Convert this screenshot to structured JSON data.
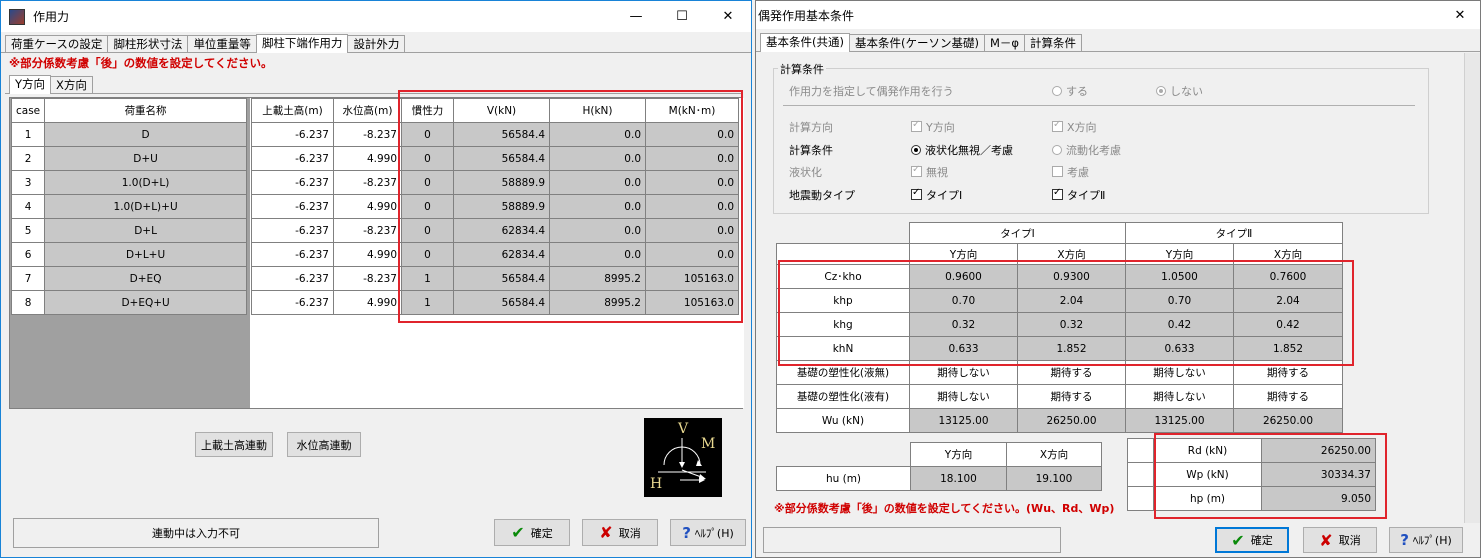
{
  "w1": {
    "title": "作用力",
    "tabs": [
      "荷重ケースの設定",
      "脚柱形状寸法",
      "単位重量等",
      "脚柱下端作用力",
      "設計外力"
    ],
    "note": "※部分係数考慮「後」の数値を設定してください。",
    "subtabs": [
      "Y方向",
      "X方向"
    ],
    "left_headers": [
      "case",
      "荷重名称"
    ],
    "right_headers": [
      "上載土高(m)",
      "水位高(m)",
      "慣性力",
      "V(kN)",
      "H(kN)",
      "M(kN･m)"
    ],
    "rows": [
      {
        "case": "1",
        "name": "D",
        "soil": "-6.237",
        "water": "-8.237",
        "inertia": "0",
        "v": "56584.4",
        "h": "0.0",
        "m": "0.0"
      },
      {
        "case": "2",
        "name": "D+U",
        "soil": "-6.237",
        "water": "4.990",
        "inertia": "0",
        "v": "56584.4",
        "h": "0.0",
        "m": "0.0"
      },
      {
        "case": "3",
        "name": "1.0(D+L)",
        "soil": "-6.237",
        "water": "-8.237",
        "inertia": "0",
        "v": "58889.9",
        "h": "0.0",
        "m": "0.0"
      },
      {
        "case": "4",
        "name": "1.0(D+L)+U",
        "soil": "-6.237",
        "water": "4.990",
        "inertia": "0",
        "v": "58889.9",
        "h": "0.0",
        "m": "0.0"
      },
      {
        "case": "5",
        "name": "D+L",
        "soil": "-6.237",
        "water": "-8.237",
        "inertia": "0",
        "v": "62834.4",
        "h": "0.0",
        "m": "0.0"
      },
      {
        "case": "6",
        "name": "D+L+U",
        "soil": "-6.237",
        "water": "4.990",
        "inertia": "0",
        "v": "62834.4",
        "h": "0.0",
        "m": "0.0"
      },
      {
        "case": "7",
        "name": "D+EQ",
        "soil": "-6.237",
        "water": "-8.237",
        "inertia": "1",
        "v": "56584.4",
        "h": "8995.2",
        "m": "105163.0"
      },
      {
        "case": "8",
        "name": "D+EQ+U",
        "soil": "-6.237",
        "water": "4.990",
        "inertia": "1",
        "v": "56584.4",
        "h": "8995.2",
        "m": "105163.0"
      }
    ],
    "btn_soil": "上載土高連動",
    "btn_water": "水位高連動",
    "diagram": {
      "v": "V",
      "m": "M",
      "h": "H"
    },
    "status": "連動中は入力不可",
    "ok": "確定",
    "cancel": "取消",
    "help": "ﾍﾙﾌﾟ(H)"
  },
  "w2": {
    "title": "偶発作用基本条件",
    "tabs": [
      "基本条件(共通)",
      "基本条件(ケーソン基礎)",
      "M－φ",
      "計算条件"
    ],
    "group_title": "計算条件",
    "opt_label": "作用力を指定して偶発作用を行う",
    "opt_yes": "する",
    "opt_no": "しない",
    "dir_label": "計算方向",
    "dir_y": "Y方向",
    "dir_x": "X方向",
    "cond_label": "計算条件",
    "cond_a": "液状化無視／考慮",
    "cond_b": "流動化考慮",
    "liq_label": "液状化",
    "liq_a": "無視",
    "liq_b": "考慮",
    "eq_label": "地震動タイプ",
    "eq_a": "タイプⅠ",
    "eq_b": "タイプⅡ",
    "type1": "タイプⅠ",
    "type2": "タイプⅡ",
    "ydir": "Y方向",
    "xdir": "X方向",
    "coef_rows": [
      {
        "label": "Cz･kho",
        "v": [
          "0.9600",
          "0.9300",
          "1.0500",
          "0.7600"
        ]
      },
      {
        "label": "khp",
        "v": [
          "0.70",
          "2.04",
          "0.70",
          "2.04"
        ]
      },
      {
        "label": "khg",
        "v": [
          "0.32",
          "0.32",
          "0.42",
          "0.42"
        ]
      },
      {
        "label": "khN",
        "v": [
          "0.633",
          "1.852",
          "0.633",
          "1.852"
        ]
      }
    ],
    "plast_rows": [
      {
        "label": "基礎の塑性化(液無)",
        "v": [
          "期待しない",
          "期待する",
          "期待しない",
          "期待する"
        ]
      },
      {
        "label": "基礎の塑性化(液有)",
        "v": [
          "期待しない",
          "期待する",
          "期待しない",
          "期待する"
        ]
      },
      {
        "label": "Wu (kN)",
        "v": [
          "13125.00",
          "26250.00",
          "13125.00",
          "26250.00"
        ]
      }
    ],
    "hu": {
      "label": "hu (m)",
      "y": "18.100",
      "x": "19.100"
    },
    "right_rows": [
      {
        "label": "Rd (kN)",
        "v": "26250.00"
      },
      {
        "label": "Wp (kN)",
        "v": "30334.37"
      },
      {
        "label": "hp (m)",
        "v": "9.050"
      }
    ],
    "note": "※部分係数考慮「後」の数値を設定してください。(Wu、Rd、Wp)",
    "ok": "確定",
    "cancel": "取消",
    "help": "ﾍﾙﾌﾟ(H)"
  }
}
